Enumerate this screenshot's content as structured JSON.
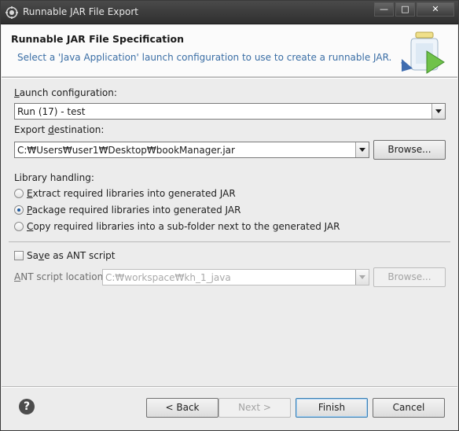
{
  "window": {
    "title": "Runnable JAR File Export",
    "minimize_glyph": "—",
    "maximize_glyph": "□",
    "close_glyph": "✕"
  },
  "banner": {
    "title": "Runnable JAR File Specification",
    "description": "Select a 'Java Application' launch configuration to use to create a runnable JAR."
  },
  "launch": {
    "label_mnemonic": "L",
    "label_rest": "aunch configuration:",
    "value": "Run (17) - test"
  },
  "export": {
    "label_pre": "Export ",
    "label_mnemonic": "d",
    "label_rest": "estination:",
    "value": "C:₩Users₩user1₩Desktop₩bookManager.jar",
    "browse_label": "Browse..."
  },
  "library": {
    "label": "Library handling:",
    "options": [
      {
        "mnemonic": "E",
        "rest": "xtract required libraries into generated JAR",
        "checked": false
      },
      {
        "mnemonic": "P",
        "rest": "ackage required libraries into generated JAR",
        "checked": true
      },
      {
        "mnemonic": "C",
        "rest": "opy required libraries into a sub-folder next to the generated JAR",
        "checked": false
      }
    ]
  },
  "ant": {
    "save_label_pre": "Sa",
    "save_label_mnemonic": "v",
    "save_label_rest": "e as ANT script",
    "save_checked": false,
    "location_label_mnemonic": "A",
    "location_label_rest": "NT script location:",
    "location_value": "C:₩workspace₩kh_1_java",
    "browse_label": "Browse..."
  },
  "footer": {
    "help_glyph": "?",
    "back_label": "< Back",
    "next_label": "Next >",
    "finish_label": "Finish",
    "cancel_label": "Cancel"
  },
  "colors": {
    "banner_description": "#3a6ea5",
    "title_bar": "#3a3a3a",
    "dialog_background": "#ececec"
  }
}
